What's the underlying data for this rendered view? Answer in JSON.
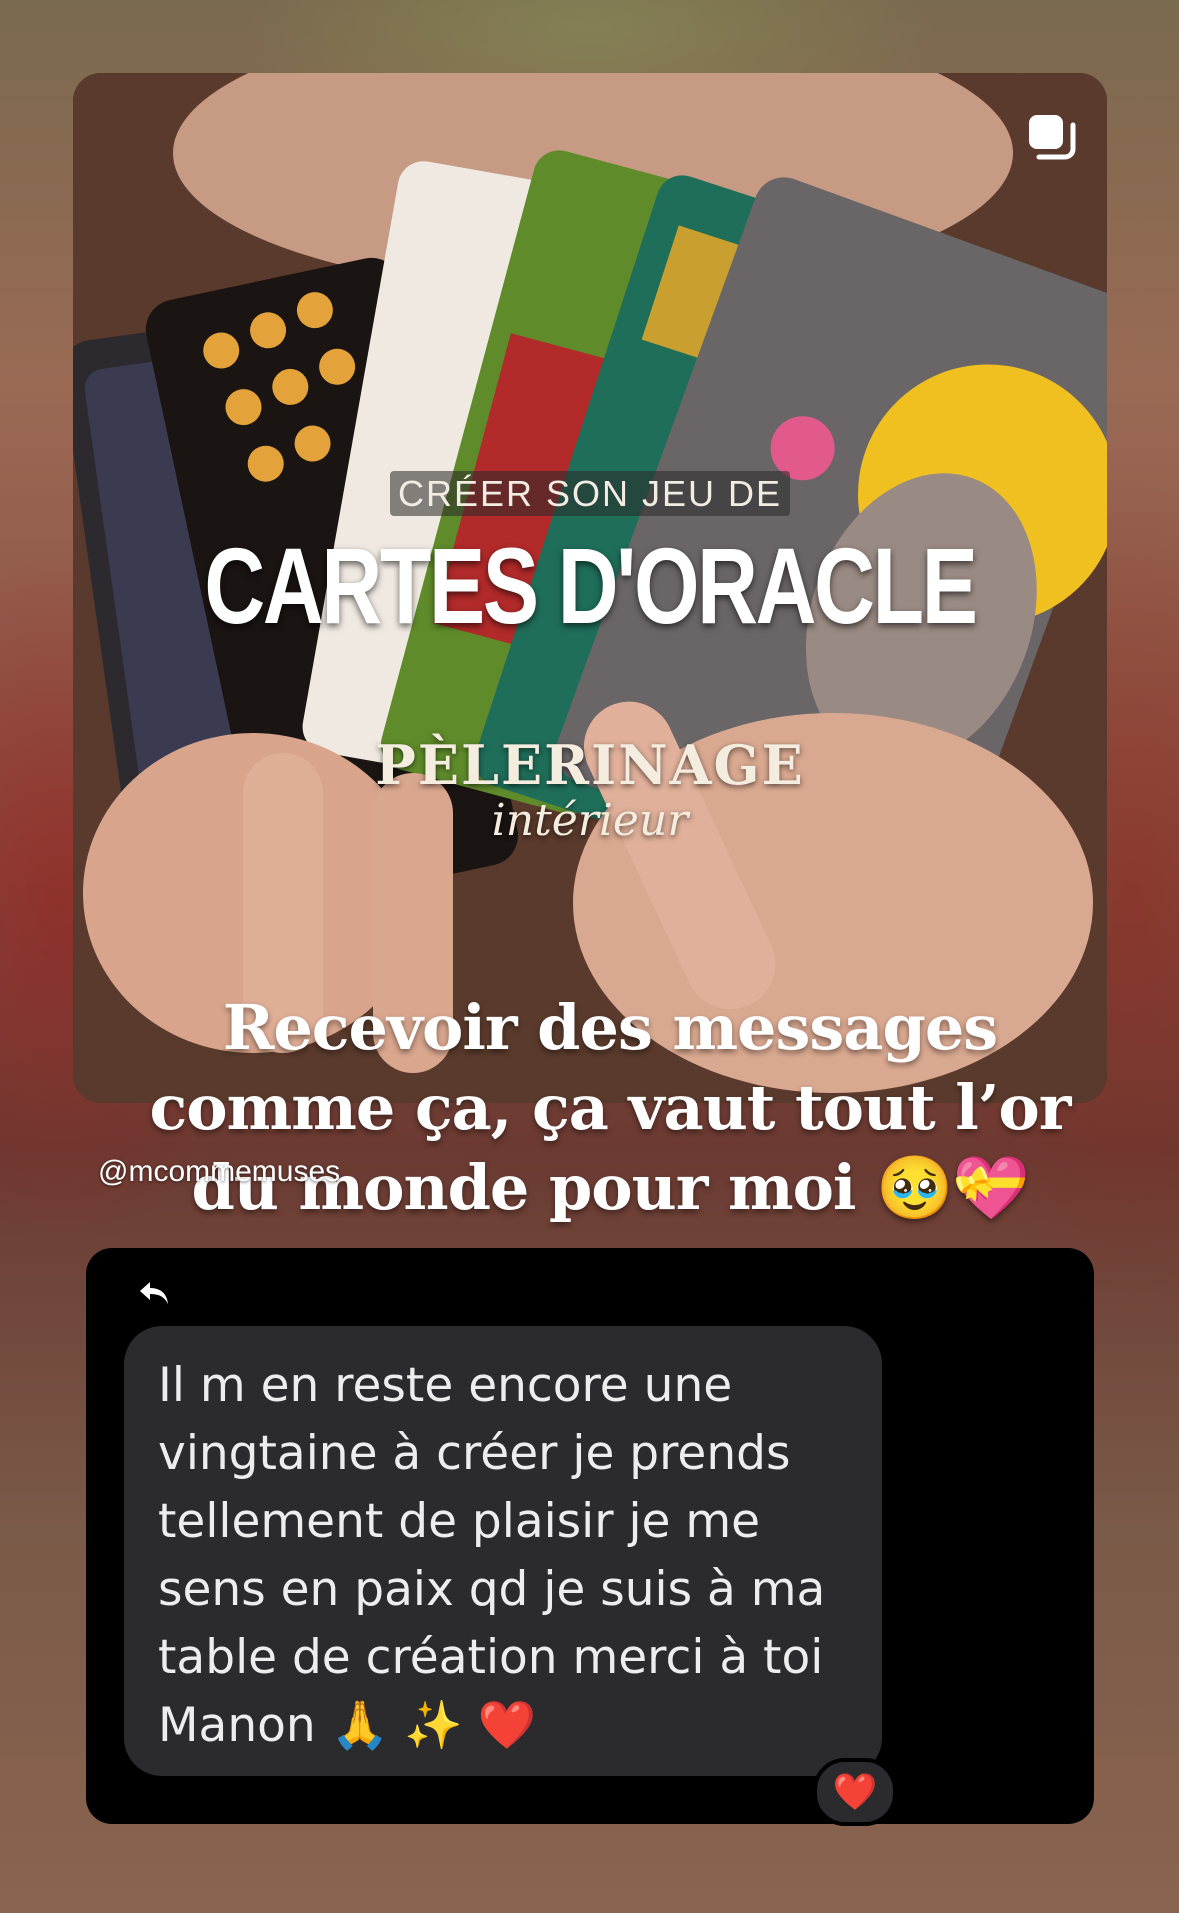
{
  "post": {
    "subtitle": "CRÉER SON JEU DE",
    "title": "CARTES D'ORACLE",
    "title2": "PÈLERINAGE",
    "title3": "intérieur"
  },
  "caption": {
    "line1": "Recevoir des messages",
    "line2": "comme ça, ça vaut tout l’or",
    "line3": "du monde pour moi 🥹💝"
  },
  "mention": "@mcommemuses",
  "dm": {
    "message": "Il m en reste encore une\nvingtaine à créer je prends\ntellement de plaisir je me\nsens en paix qd je suis à ma\ntable de création merci à toi\nManon 🙏 ✨ ❤️",
    "reaction": "❤️"
  },
  "icons": {
    "multi_post": "multiple-images-icon",
    "reply": "reply-arrow-icon"
  }
}
